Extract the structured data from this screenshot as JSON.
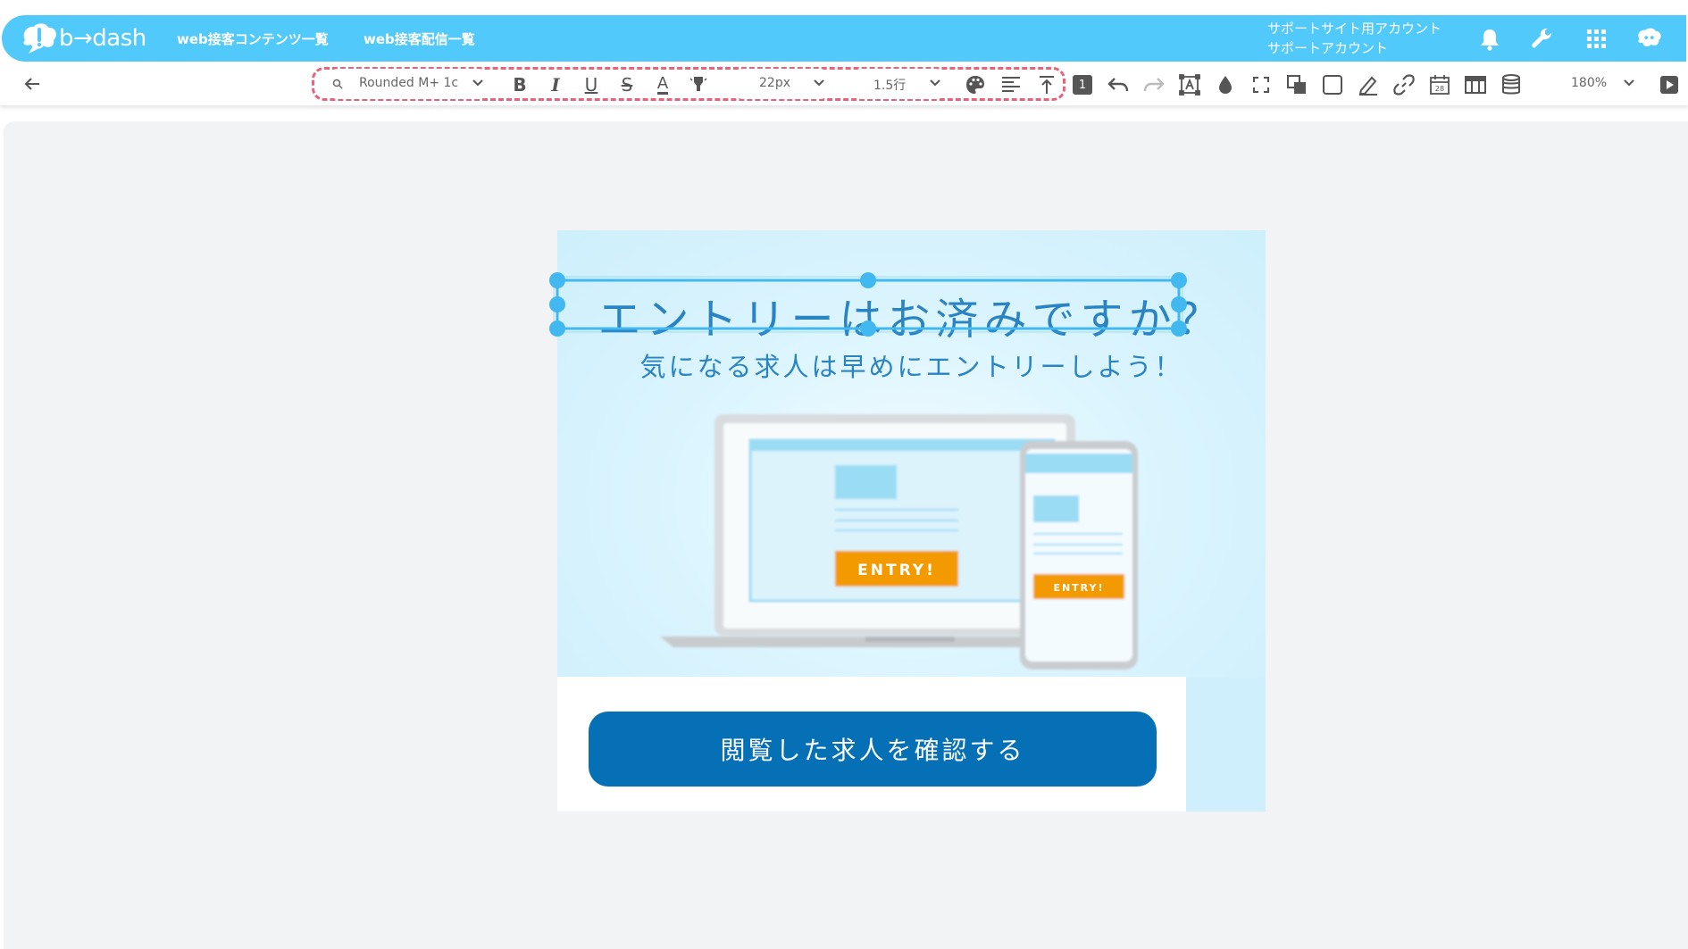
{
  "header": {
    "logo_text": "b→dash",
    "nav": [
      "web接客コンテンツ一覧",
      "web接客配信一覧"
    ],
    "account_line1": "サポートサイト用アカウント",
    "account_line2": "サポートアカウント",
    "icons": [
      "bell-icon",
      "wrench-icon",
      "grid-apps-icon",
      "user-menu-icon"
    ]
  },
  "toolbar": {
    "font_family": "Rounded M+ 1c",
    "font_size": "22px",
    "line_height": "1.5行",
    "layer_badge": "1",
    "zoom": "180%",
    "icons": [
      "back-arrow-icon",
      "search-icon",
      "bold-icon",
      "italic-icon",
      "underline-icon",
      "strikethrough-icon",
      "text-color-icon",
      "highlight-icon",
      "palette-icon",
      "align-left-icon",
      "vertical-align-top-icon",
      "undo-icon",
      "redo-icon",
      "text-box-icon",
      "fill-drop-icon",
      "fullscreen-icon",
      "layer-order-icon",
      "border-icon",
      "pen-icon",
      "link-icon",
      "calendar-icon",
      "table-icon",
      "database-icon",
      "play-icon"
    ],
    "accent_dashed": "#e8637a"
  },
  "banner": {
    "headline": "エントリーはお済みですか？",
    "subline": "気になる求人は早めにエントリーしよう！",
    "laptop_button": "ENTRY!",
    "phone_button": "ENTRY!",
    "cta": "閲覧した求人を確認する",
    "colors": {
      "primary": "#0570b6",
      "text": "#2a83c2",
      "bg": "#cfeffc",
      "selection": "#41b8f0",
      "entry": "#f39a00"
    }
  }
}
